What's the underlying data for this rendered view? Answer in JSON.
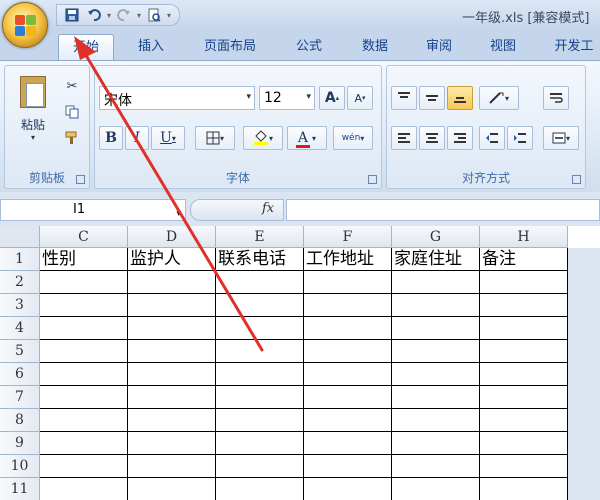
{
  "window": {
    "title": "一年级.xls  [兼容模式]"
  },
  "quick_access": {
    "save_icon": "save-icon",
    "undo_icon": "undo-icon",
    "redo_icon": "redo-icon",
    "print_preview_icon": "print-preview-icon",
    "customize_icon": "customize-icon"
  },
  "tabs": [
    {
      "label": "开始"
    },
    {
      "label": "插入"
    },
    {
      "label": "页面布局"
    },
    {
      "label": "公式"
    },
    {
      "label": "数据"
    },
    {
      "label": "审阅"
    },
    {
      "label": "视图"
    },
    {
      "label": "开发工"
    }
  ],
  "ribbon": {
    "clipboard": {
      "paste_label": "粘贴",
      "group_label": "剪贴板"
    },
    "font": {
      "font_name": "宋体",
      "font_size": "12",
      "group_label": "字体",
      "bold": "B",
      "italic": "I",
      "underline": "U",
      "grow": "A",
      "shrink": "A",
      "font_color": "A",
      "phonetic": "wén"
    },
    "alignment": {
      "group_label": "对齐方式"
    }
  },
  "formula_bar": {
    "name_box": "I1",
    "fx_label": "fx",
    "formula": ""
  },
  "sheet": {
    "columns": [
      "C",
      "D",
      "E",
      "F",
      "G",
      "H"
    ],
    "rows": [
      "1",
      "2",
      "3",
      "4",
      "5",
      "6",
      "7",
      "8",
      "9",
      "10",
      "11"
    ],
    "header_row": [
      "性别",
      "监护人",
      "联系电话",
      "工作地址",
      "家庭住址",
      "备注"
    ]
  },
  "colors": {
    "annotation_arrow": "#e0302a",
    "tab_text": "#15428b"
  }
}
